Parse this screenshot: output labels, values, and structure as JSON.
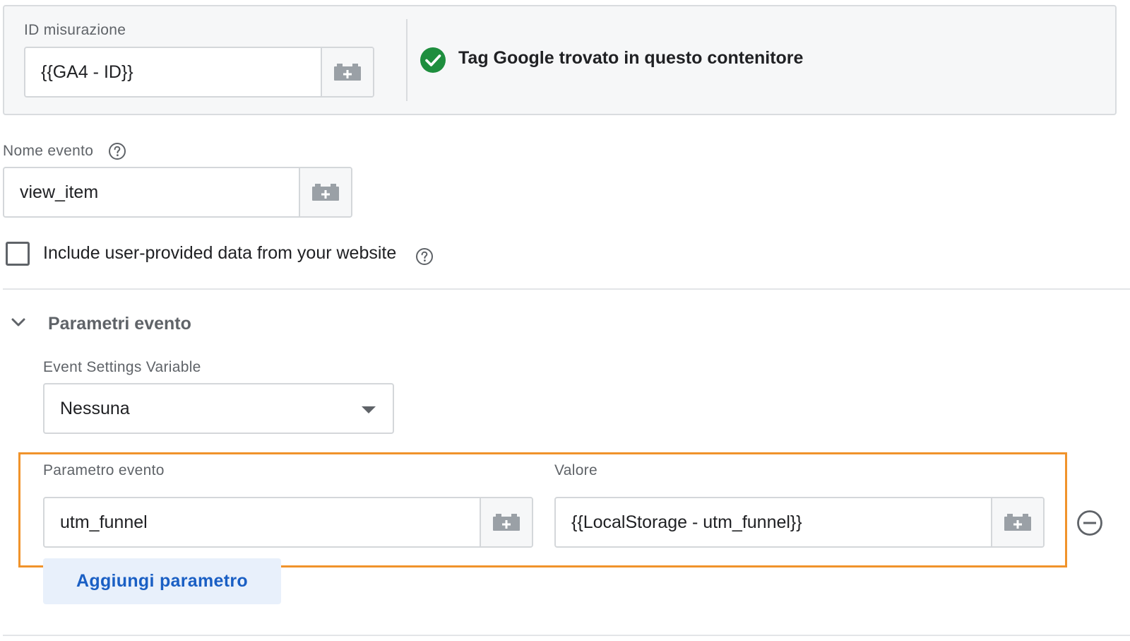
{
  "measurement": {
    "label": "ID misurazione",
    "value": "{{GA4 - ID}}",
    "status_text": "Tag Google trovato in questo contenitore"
  },
  "event_name": {
    "label": "Nome evento",
    "value": "view_item"
  },
  "user_data": {
    "checkbox_label": "Include user-provided data from your website",
    "checked": false
  },
  "event_params": {
    "section_title": "Parametri evento",
    "settings_variable_label": "Event Settings Variable",
    "settings_variable_value": "Nessuna",
    "param_label": "Parametro evento",
    "value_label": "Valore",
    "rows": [
      {
        "param": "utm_funnel",
        "value": "{{LocalStorage - utm_funnel}}"
      }
    ],
    "add_button_label": "Aggiungi parametro"
  },
  "icons": {
    "variable": "add-variable-icon",
    "status": "check-circle-icon",
    "help": "help-circle-icon",
    "collapse": "chevron-down-icon",
    "remove": "remove-circle-icon"
  },
  "colors": {
    "success": "#1e8e3e",
    "highlight_border": "#f0932b",
    "link_blue": "#1a5fc4",
    "add_button_bg": "#e8f0fb"
  }
}
